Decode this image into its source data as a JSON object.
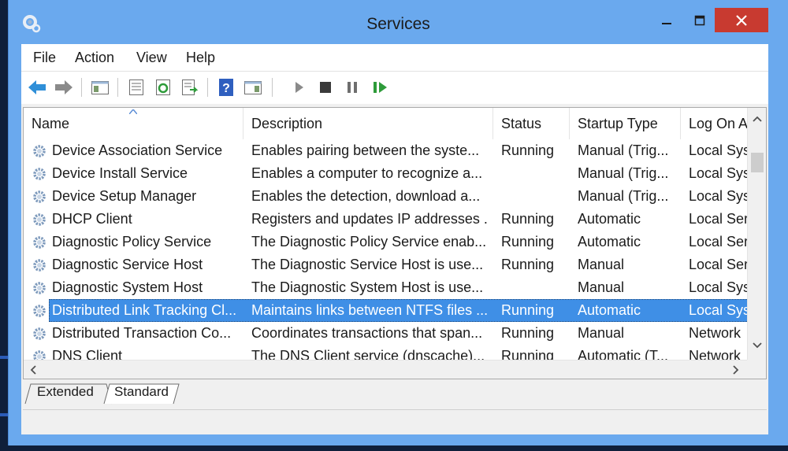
{
  "window": {
    "title": "Services"
  },
  "menu": {
    "items": [
      "File",
      "Action",
      "View",
      "Help"
    ]
  },
  "toolbar": {
    "buttons": [
      "back-icon",
      "forward-icon",
      "show-hide-console-tree-icon",
      "properties-icon",
      "refresh-icon",
      "export-list-icon",
      "help-icon",
      "show-hide-action-pane-icon",
      "start-service-icon",
      "stop-service-icon",
      "pause-service-icon",
      "restart-service-icon"
    ]
  },
  "list": {
    "columns": [
      "Name",
      "Description",
      "Status",
      "Startup Type",
      "Log On A"
    ],
    "rows": [
      {
        "name": "Device Association Service",
        "description": "Enables pairing between the syste...",
        "status": "Running",
        "startup": "Manual (Trig...",
        "logon": "Local Sys"
      },
      {
        "name": "Device Install Service",
        "description": "Enables a computer to recognize a...",
        "status": "",
        "startup": "Manual (Trig...",
        "logon": "Local Sys"
      },
      {
        "name": "Device Setup Manager",
        "description": "Enables the detection, download a...",
        "status": "",
        "startup": "Manual (Trig...",
        "logon": "Local Sys"
      },
      {
        "name": "DHCP Client",
        "description": "Registers and updates IP addresses ...",
        "status": "Running",
        "startup": "Automatic",
        "logon": "Local Ser"
      },
      {
        "name": "Diagnostic Policy Service",
        "description": "The Diagnostic Policy Service enab...",
        "status": "Running",
        "startup": "Automatic",
        "logon": "Local Ser"
      },
      {
        "name": "Diagnostic Service Host",
        "description": "The Diagnostic Service Host is use...",
        "status": "Running",
        "startup": "Manual",
        "logon": "Local Ser"
      },
      {
        "name": "Diagnostic System Host",
        "description": "The Diagnostic System Host is use...",
        "status": "",
        "startup": "Manual",
        "logon": "Local Sys"
      },
      {
        "name": "Distributed Link Tracking Cl...",
        "description": "Maintains links between NTFS files ...",
        "status": "Running",
        "startup": "Automatic",
        "logon": "Local Sys"
      },
      {
        "name": "Distributed Transaction Co...",
        "description": "Coordinates transactions that span...",
        "status": "Running",
        "startup": "Manual",
        "logon": "Network"
      },
      {
        "name": "DNS Client",
        "description": "The DNS Client service (dnscache)...",
        "status": "Running",
        "startup": "Automatic (T...",
        "logon": "Network"
      }
    ],
    "selected_index": 7
  },
  "tabs": [
    "Extended",
    "Standard"
  ],
  "active_tab": "Standard",
  "colors": {
    "titlebar": "#6aa9ee",
    "close": "#c83a30",
    "selection": "#3f8fe6"
  }
}
